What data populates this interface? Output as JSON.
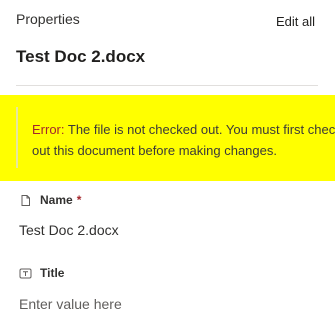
{
  "header": {
    "title": "Properties",
    "edit_all_label": "Edit all"
  },
  "document": {
    "name": "Test Doc 2.docx"
  },
  "error": {
    "prefix": "Error:",
    "message": " The file is not checked out. You must first check out this document before making changes."
  },
  "fields": [
    {
      "label": "Name",
      "required_marker": "*",
      "icon": "document-icon",
      "value": "Test Doc 2.docx"
    },
    {
      "label": "Title",
      "icon": "text-field-icon",
      "placeholder": "Enter value here"
    }
  ],
  "colors": {
    "error_highlight": "#ffff00",
    "error_text": "#a4262c",
    "separator": "#e1dfdd"
  }
}
